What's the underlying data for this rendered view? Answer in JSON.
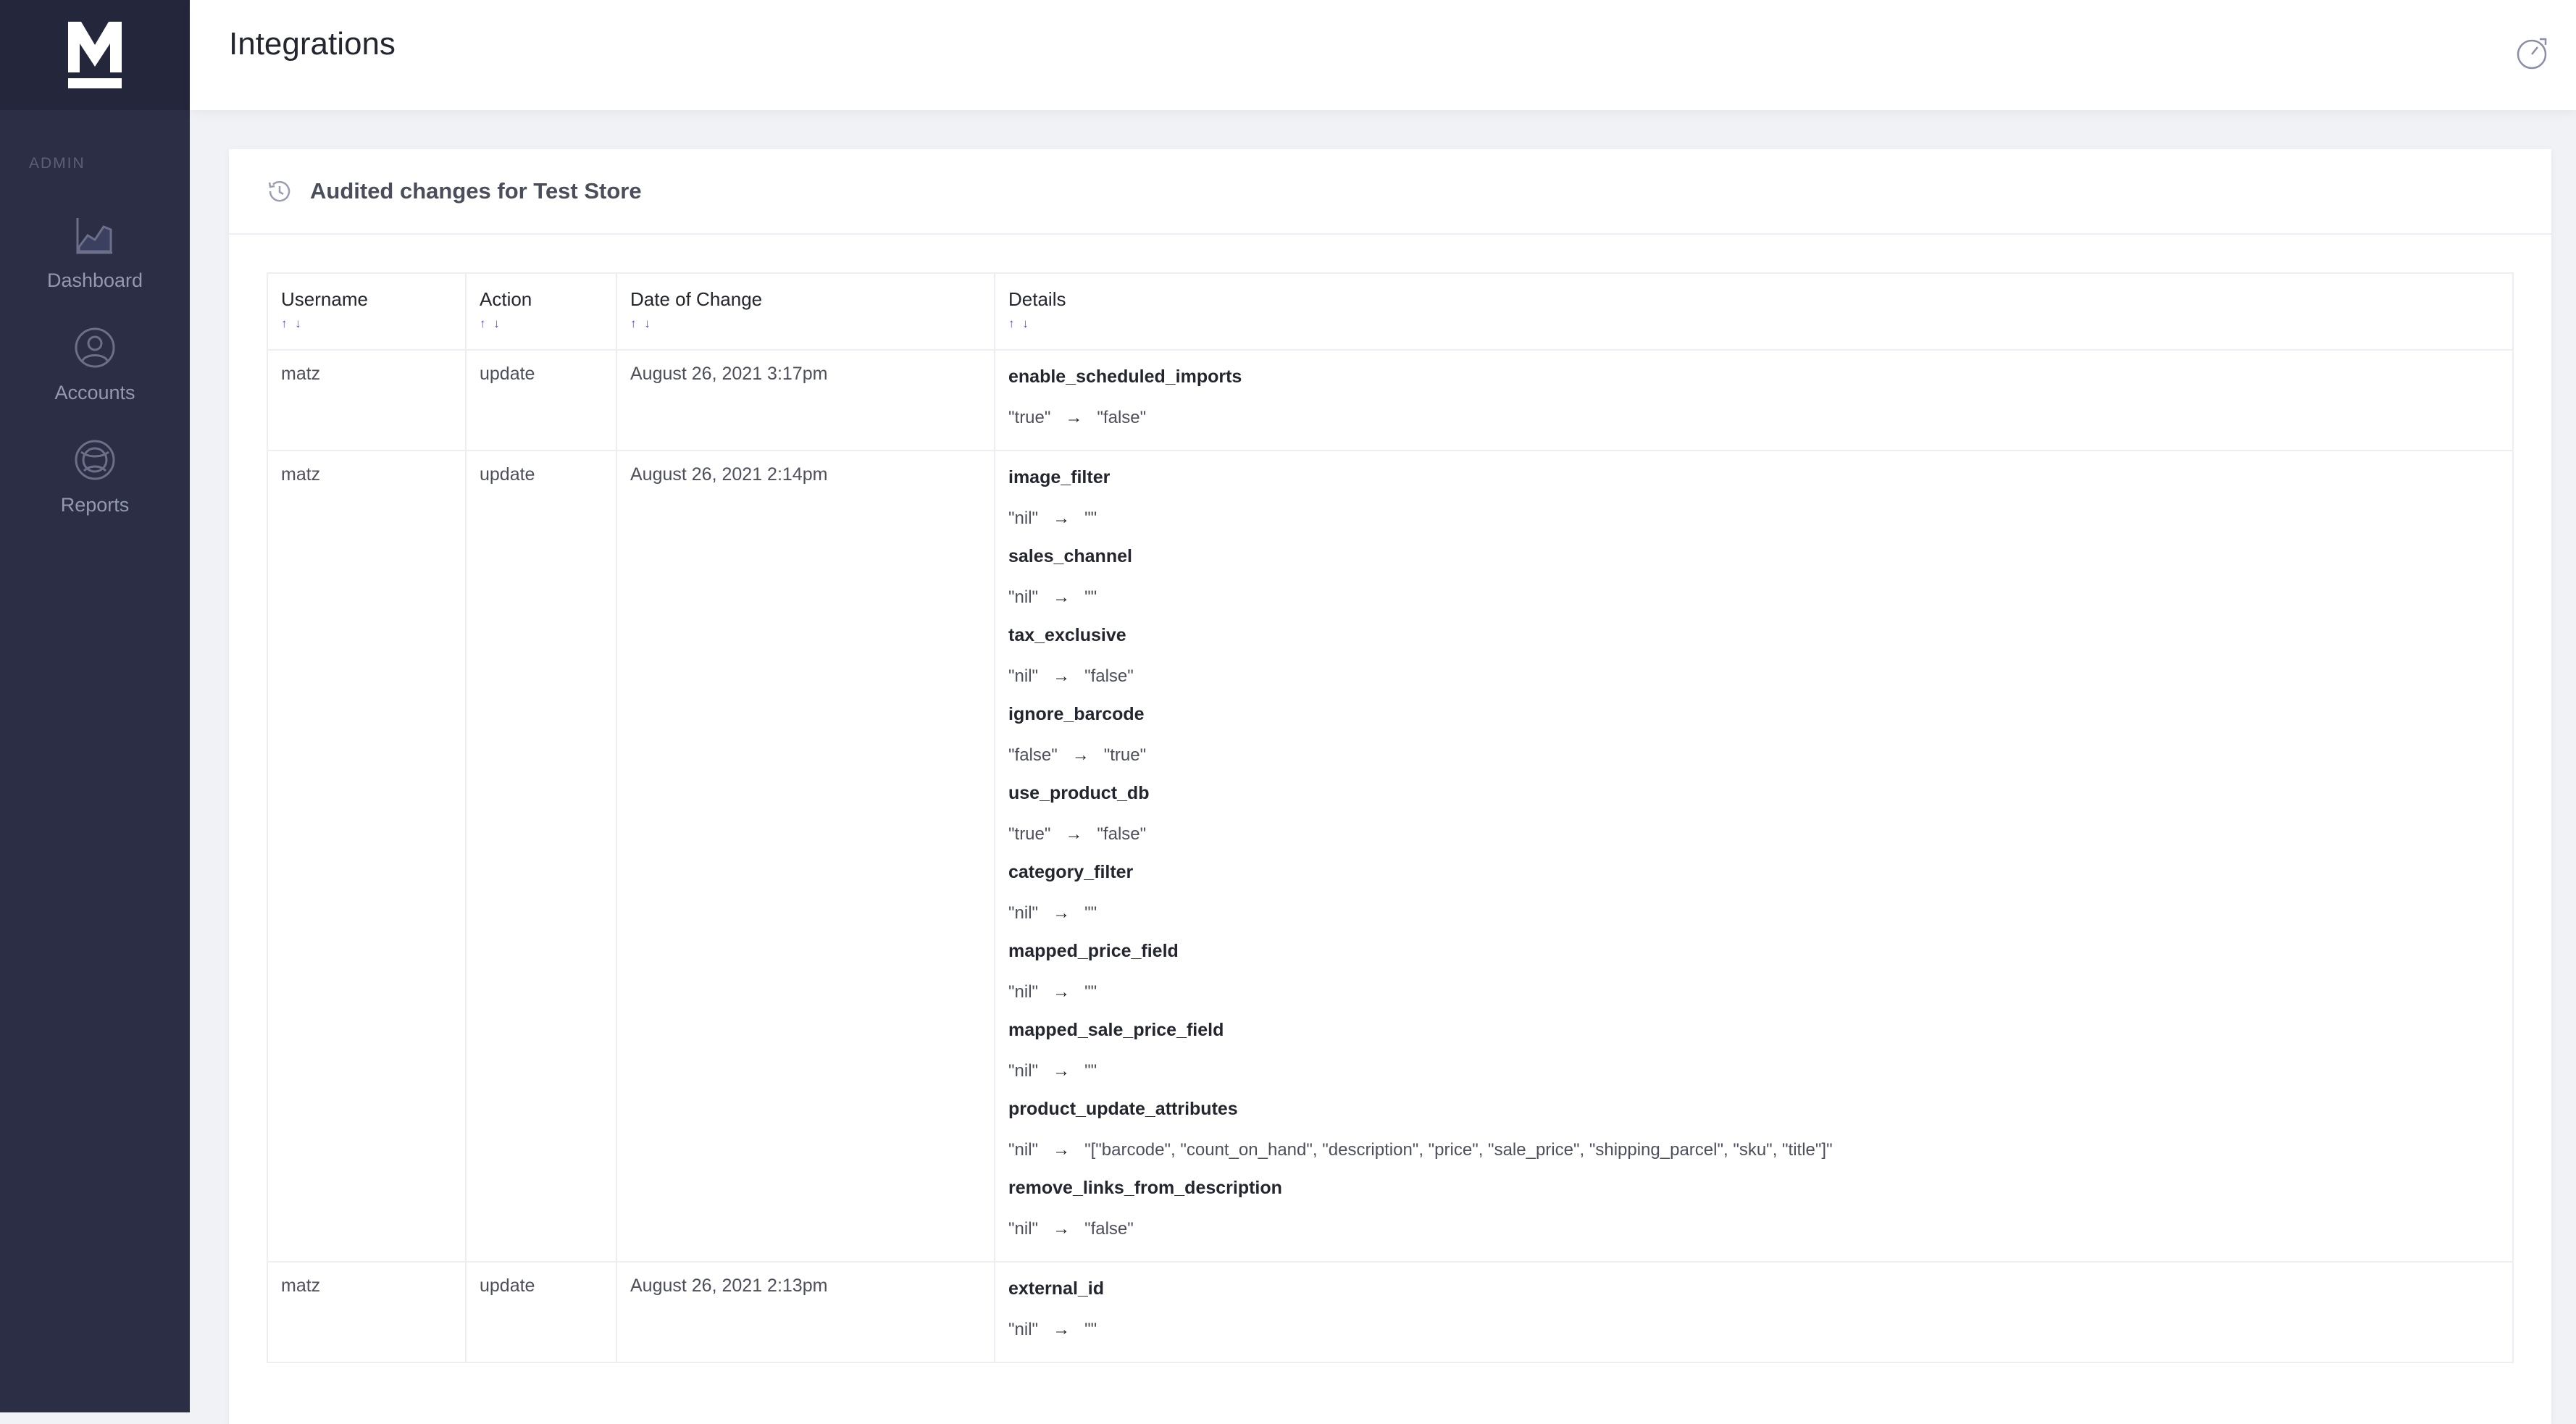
{
  "sidebar": {
    "section_label": "ADMIN",
    "items": [
      {
        "label": "Dashboard",
        "icon": "chart-icon"
      },
      {
        "label": "Accounts",
        "icon": "user-circle-icon"
      },
      {
        "label": "Reports",
        "icon": "globe-icon"
      }
    ]
  },
  "header": {
    "title": "Integrations",
    "right_icon": "speedometer-icon"
  },
  "card": {
    "title": "Audited changes for Test Store",
    "icon": "history-icon"
  },
  "table": {
    "columns": [
      {
        "label": "Username",
        "sort": "↑ ↓"
      },
      {
        "label": "Action",
        "sort": "↑ ↓"
      },
      {
        "label": "Date of Change",
        "sort": "↑ ↓"
      },
      {
        "label": "Details",
        "sort": "↑ ↓"
      }
    ],
    "rows": [
      {
        "username": "matz",
        "action": "update",
        "date": "August 26, 2021 3:17pm",
        "changes": [
          {
            "field": "enable_scheduled_imports",
            "from": "\"true\"",
            "to": "\"false\""
          }
        ]
      },
      {
        "username": "matz",
        "action": "update",
        "date": "August 26, 2021 2:14pm",
        "changes": [
          {
            "field": "image_filter",
            "from": "\"nil\"",
            "to": "\"\""
          },
          {
            "field": "sales_channel",
            "from": "\"nil\"",
            "to": "\"\""
          },
          {
            "field": "tax_exclusive",
            "from": "\"nil\"",
            "to": "\"false\""
          },
          {
            "field": "ignore_barcode",
            "from": "\"false\"",
            "to": "\"true\""
          },
          {
            "field": "use_product_db",
            "from": "\"true\"",
            "to": "\"false\""
          },
          {
            "field": "category_filter",
            "from": "\"nil\"",
            "to": "\"\""
          },
          {
            "field": "mapped_price_field",
            "from": "\"nil\"",
            "to": "\"\""
          },
          {
            "field": "mapped_sale_price_field",
            "from": "\"nil\"",
            "to": "\"\""
          },
          {
            "field": "product_update_attributes",
            "from": "\"nil\"",
            "to": "\"[\"barcode\", \"count_on_hand\", \"description\", \"price\", \"sale_price\", \"shipping_parcel\", \"sku\", \"title\"]\""
          },
          {
            "field": "remove_links_from_description",
            "from": "\"nil\"",
            "to": "\"false\""
          }
        ]
      },
      {
        "username": "matz",
        "action": "update",
        "date": "August 26, 2021 2:13pm",
        "changes": [
          {
            "field": "external_id",
            "from": "\"nil\"",
            "to": "\"\""
          }
        ]
      }
    ],
    "arrow": "→"
  },
  "colors": {
    "sidebar_bg": "#2b2e45",
    "logo_bg": "#24273b",
    "accent": "#4b53c9",
    "page_bg": "#f1f2f6"
  }
}
